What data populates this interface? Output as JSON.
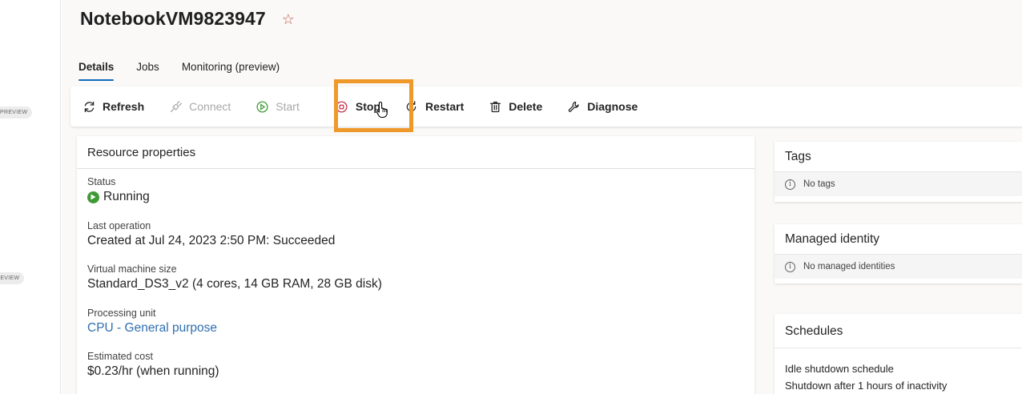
{
  "leftnav": {
    "badges": [
      "PREVIEW",
      "PREVIEW"
    ]
  },
  "header": {
    "title": "NotebookVM9823947",
    "favorite_icon": "star-outline-icon"
  },
  "tabs": [
    {
      "label": "Details",
      "active": true
    },
    {
      "label": "Jobs",
      "active": false
    },
    {
      "label": "Monitoring (preview)",
      "active": false
    }
  ],
  "toolbar": {
    "refresh": "Refresh",
    "connect": "Connect",
    "start": "Start",
    "stop": "Stop",
    "restart": "Restart",
    "delete": "Delete",
    "diagnose": "Diagnose",
    "highlight_color": "#f0992b"
  },
  "resource": {
    "title": "Resource properties",
    "status_label": "Status",
    "status_value": "Running",
    "status_color": "#3f9a35",
    "last_op_label": "Last operation",
    "last_op_value": "Created at Jul 24, 2023 2:50 PM: Succeeded",
    "vm_size_label": "Virtual machine size",
    "vm_size_value": "Standard_DS3_v2 (4 cores, 14 GB RAM, 28 GB disk)",
    "processing_label": "Processing unit",
    "processing_cpu": "CPU",
    "processing_sep": " - ",
    "processing_type": "General purpose",
    "cost_label": "Estimated cost",
    "cost_value": "$0.23/hr (when running)"
  },
  "tags": {
    "title": "Tags",
    "empty": "No tags"
  },
  "identity": {
    "title": "Managed identity",
    "empty": "No managed identities"
  },
  "schedules": {
    "title": "Schedules",
    "idle_label": "Idle shutdown schedule",
    "idle_value": "Shutdown after 1 hours of inactivity"
  }
}
